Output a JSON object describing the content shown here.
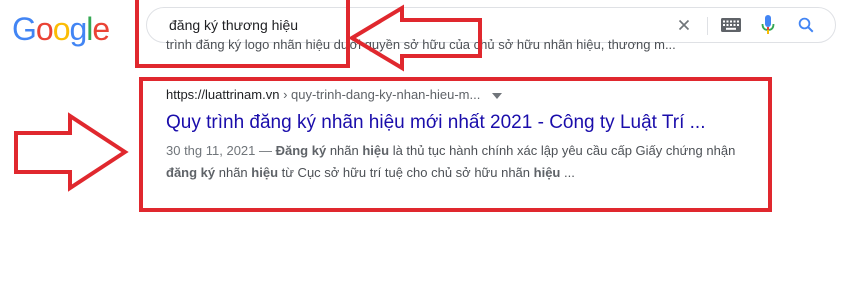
{
  "logo": {
    "letters": [
      "G",
      "o",
      "o",
      "g",
      "l",
      "e"
    ],
    "colors": [
      "#4285f4",
      "#ea4335",
      "#fbbc05",
      "#4285f4",
      "#34a853",
      "#ea4335"
    ]
  },
  "search": {
    "value": "đăng ký thương hiệu"
  },
  "icons": {
    "clear": "close-icon",
    "keyboard": "keyboard-icon",
    "mic": "mic-icon",
    "search": "search-icon"
  },
  "previous_result": {
    "snippet": "trình đăng ký logo nhãn hiệu dưới quyền sở hữu của chủ sở hữu nhãn hiệu, thương m..."
  },
  "result": {
    "url_domain": "https://luattrinam.vn",
    "url_path": " › quy-trinh-dang-ky-nhan-hieu-m...",
    "title": "Quy trình đăng ký nhãn hiệu mới nhất 2021 - Công ty Luật Trí ...",
    "date": "30 thg 11, 2021 — ",
    "snippet_parts": [
      "Đăng ký",
      " nhãn ",
      "hiệu",
      " là thủ tục hành chính xác lập yêu cầu cấp Giấy chứng nhận ",
      "đăng ký",
      " nhãn ",
      "hiệu",
      " từ Cục sở hữu trí tuệ cho chủ sở hữu nhãn ",
      "hiệu",
      " ..."
    ]
  },
  "annotation": {
    "color": "#e0282e"
  }
}
